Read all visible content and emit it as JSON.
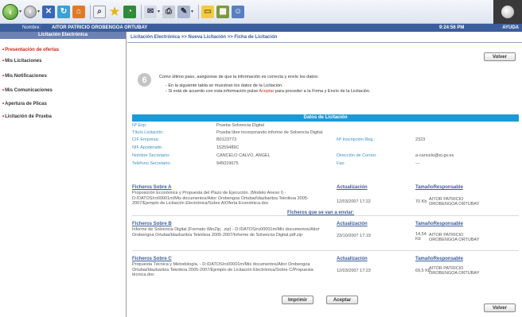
{
  "header": {
    "nombre_label": "Nombre:",
    "user": "AITOR PATRICIO OROBENGOA ORTUBAY",
    "time": "9:24:56 PM",
    "ayuda": "AYUDA"
  },
  "sidebar": {
    "title": "Licitación Electrónica",
    "items": [
      "Presentación de ofertas",
      "Mis Licitaciones",
      "Mis Notificaciones",
      "Mis Comunicaciones",
      "Apertura de Plicas",
      "Licitación de Prueba"
    ]
  },
  "main": {
    "breadcrumb": "Licitación Electrónica >> Nueva Licitación >> Ficha de Licitación",
    "volver": "Volver",
    "step_number": "6",
    "intro": "Como último paso, asegúrese de que la información es correcta y envíe los datos:",
    "bullet1": "- En la siguiente tabla se muestran los datos de la Licitación.",
    "bullet2_pre": "- Si está de acuerdo con esta información pulse ",
    "bullet2_link": "Aceptar",
    "bullet2_post": " para proceder a la Firma y Envío de la Licitación."
  },
  "datos": {
    "title": "Datos de Licitación",
    "rows": [
      {
        "label": "Nº Exp:",
        "value": "Prueba Solvencia Digital"
      },
      {
        "label": "Título Licitación:",
        "value": "Prueba libre incorporando informe de Solvencia Digital."
      },
      {
        "label": "CIF Empresa:",
        "value": "B0123773"
      },
      {
        "label": "NIF Apoderado:",
        "value": "15259489C"
      },
      {
        "label": "Nombre Secretario:",
        "value": "CANCELO CALVO, ANGEL"
      },
      {
        "label": "Teléfono Secretario:",
        "value": "945019675"
      }
    ],
    "right": [
      {
        "label": "Nº Inscripción Reg.:",
        "value": "2323"
      },
      {
        "label": "Dirección de Correo:",
        "value": "a-cancelo@ej-gv.es"
      },
      {
        "label": "Fax:",
        "value": "---"
      }
    ]
  },
  "ficheros": {
    "title": "Ficheros que se van a enviar:",
    "col_actualizacion": "Actualización",
    "col_tamano": "Tamaño",
    "col_responsable": "Responsable",
    "items": [
      {
        "name": "Ficheros Sobre A",
        "desc": "Proposición Económica y Propuesta del Plazo de Ejecución. (Modelo Anexo I) - D:/DATOS/ro00001m/Mis documentos/Aitor Orobengoa Ortubai/Idazkaritza Teknikoa 2005-2007/Ejemplo de Licitación Electrónica/Sobre A/Oferta Económica.doc",
        "date": "12/03/2007 17:22",
        "size": "70 Kb",
        "resp": "AITOR PATRICIO OROBENGOA ORTUBAY"
      },
      {
        "name": "Ficheros Sobre B",
        "desc": "Informe de Solvencia Digital (Formato WinZip, .zip) - D:/DATOS/ro00001m/Mis documentos/Aitor Orobengoa Ortubai/Idazkaritza Teknikoa 2005-2007/Informe de Solvencia Digital.pdf.zip",
        "date": "23/10/2007 17:19",
        "size": "14,54 Kb",
        "resp": "AITOR PATRICIO OROBENGOA ORTUBAY"
      },
      {
        "name": "Ficheros Sobre C",
        "desc": "Propuesta Técnica y Metodología. - D:/DATOS/ro00001m/Mis documentos/Aitor Orobengoa Ortubai/Idazkaritza Teknikoa 2005-2007/Ejemplo de Licitación Electrónica/Sobre C/Propuesta técnica.doc",
        "date": "12/03/2007 17:23",
        "size": "69,5 Kb",
        "resp": "AITOR PATRICIO OROBENGOA ORTUBAY"
      }
    ]
  },
  "actions": {
    "imprimir": "Imprimir",
    "aceptar": "Aceptar",
    "volver": "Volver"
  },
  "colors": {
    "header_blue": "#3b5d9c",
    "table_header": "#1c9ad6",
    "active_red": "#d2261c"
  }
}
